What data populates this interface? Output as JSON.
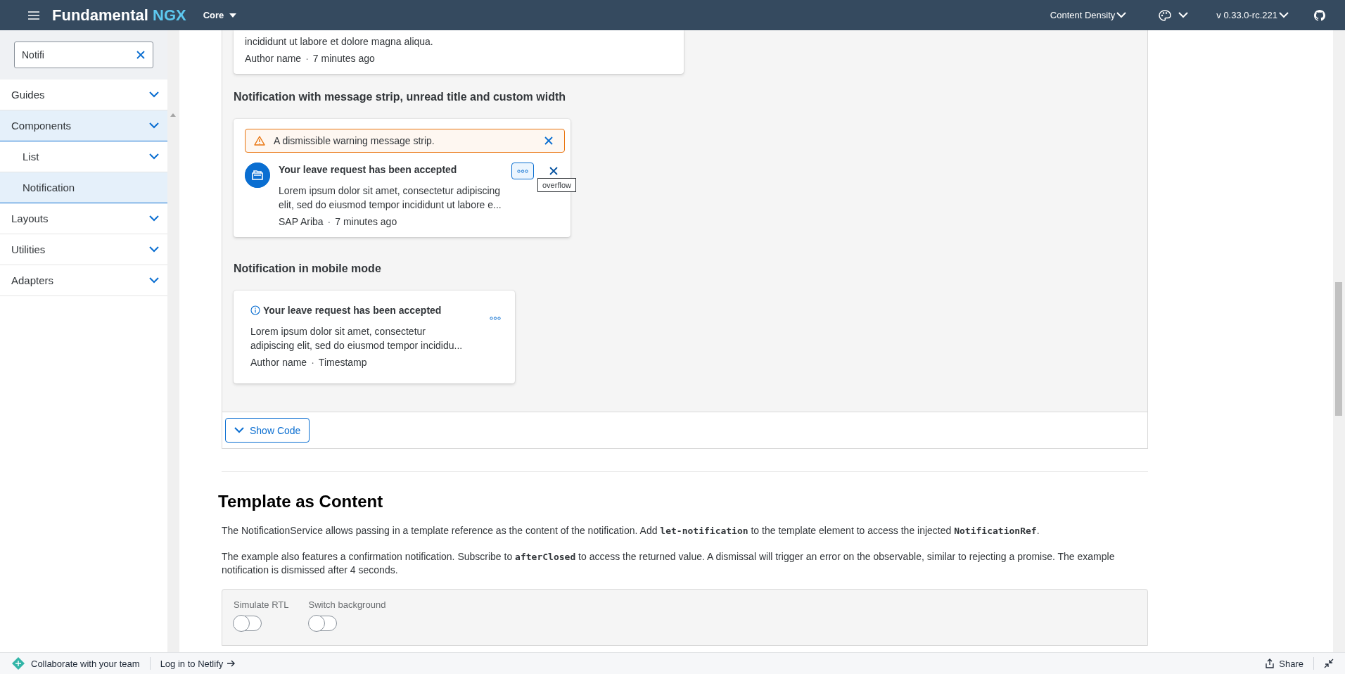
{
  "header": {
    "brand": "Fundamental",
    "brand_accent": "NGX",
    "library": "Core",
    "density": "Content Density",
    "version": "v 0.33.0-rc.221"
  },
  "sidebar": {
    "search": {
      "value": "Notifi"
    },
    "items": [
      {
        "label": "Guides",
        "kind": "group",
        "selected": false
      },
      {
        "label": "Components",
        "kind": "group",
        "selected": true,
        "children": [
          {
            "label": "List",
            "kind": "group",
            "selected": false
          },
          {
            "label": "Notification",
            "kind": "page",
            "selected": true
          }
        ]
      },
      {
        "label": "Layouts",
        "kind": "group",
        "selected": false
      },
      {
        "label": "Utilities",
        "kind": "group",
        "selected": false
      },
      {
        "label": "Adapters",
        "kind": "group",
        "selected": false
      }
    ]
  },
  "example": {
    "partial_card": {
      "text": "incididunt ut labore et dolore magna aliqua.",
      "author": "Author name",
      "separator": "·",
      "time": "7 minutes ago"
    },
    "strip_section": {
      "heading": "Notification with message strip, unread title and custom width",
      "strip": "A dismissible warning message strip.",
      "title": "Your leave request has been accepted",
      "unread": true,
      "body": "Lorem ipsum dolor sit amet, consectetur adipiscing elit, sed do eiusmod tempor incididunt ut labore e...",
      "author": "SAP Ariba",
      "separator": "·",
      "time": "7 minutes ago",
      "tooltip": "overflow"
    },
    "mobile_section": {
      "heading": "Notification in mobile mode",
      "title": "Your leave request has been accepted",
      "unread": true,
      "body": "Lorem ipsum dolor sit amet, consectetur adipiscing elit, sed do eiusmod tempor incididu...",
      "author": "Author name",
      "separator": "·",
      "time": "Timestamp"
    },
    "show_code": "Show Code"
  },
  "template_section": {
    "heading": "Template as Content",
    "paragraphs": [
      [
        {
          "kind": "text",
          "text": "The NotificationService allows passing in a template reference as the content of the notification. Add "
        },
        {
          "kind": "code",
          "text": "let-notification"
        },
        {
          "kind": "text",
          "text": " to the template element to access the injected "
        },
        {
          "kind": "code",
          "text": "NotificationRef"
        },
        {
          "kind": "text",
          "text": "."
        }
      ],
      [
        {
          "kind": "text",
          "text": "The example also features a confirmation notification. Subscribe to "
        },
        {
          "kind": "code",
          "text": "afterClosed"
        },
        {
          "kind": "text",
          "text": " to access the returned value. A dismissal will trigger an error on the observable, similar to rejecting a promise. The example notification is dismissed after 4 seconds."
        }
      ]
    ],
    "toggles": [
      {
        "label": "Simulate RTL",
        "on": false
      },
      {
        "label": "Switch background",
        "on": false
      }
    ]
  },
  "footer": {
    "collaborate": "Collaborate with your team",
    "login": "Log in to Netlify",
    "share": "Share"
  }
}
